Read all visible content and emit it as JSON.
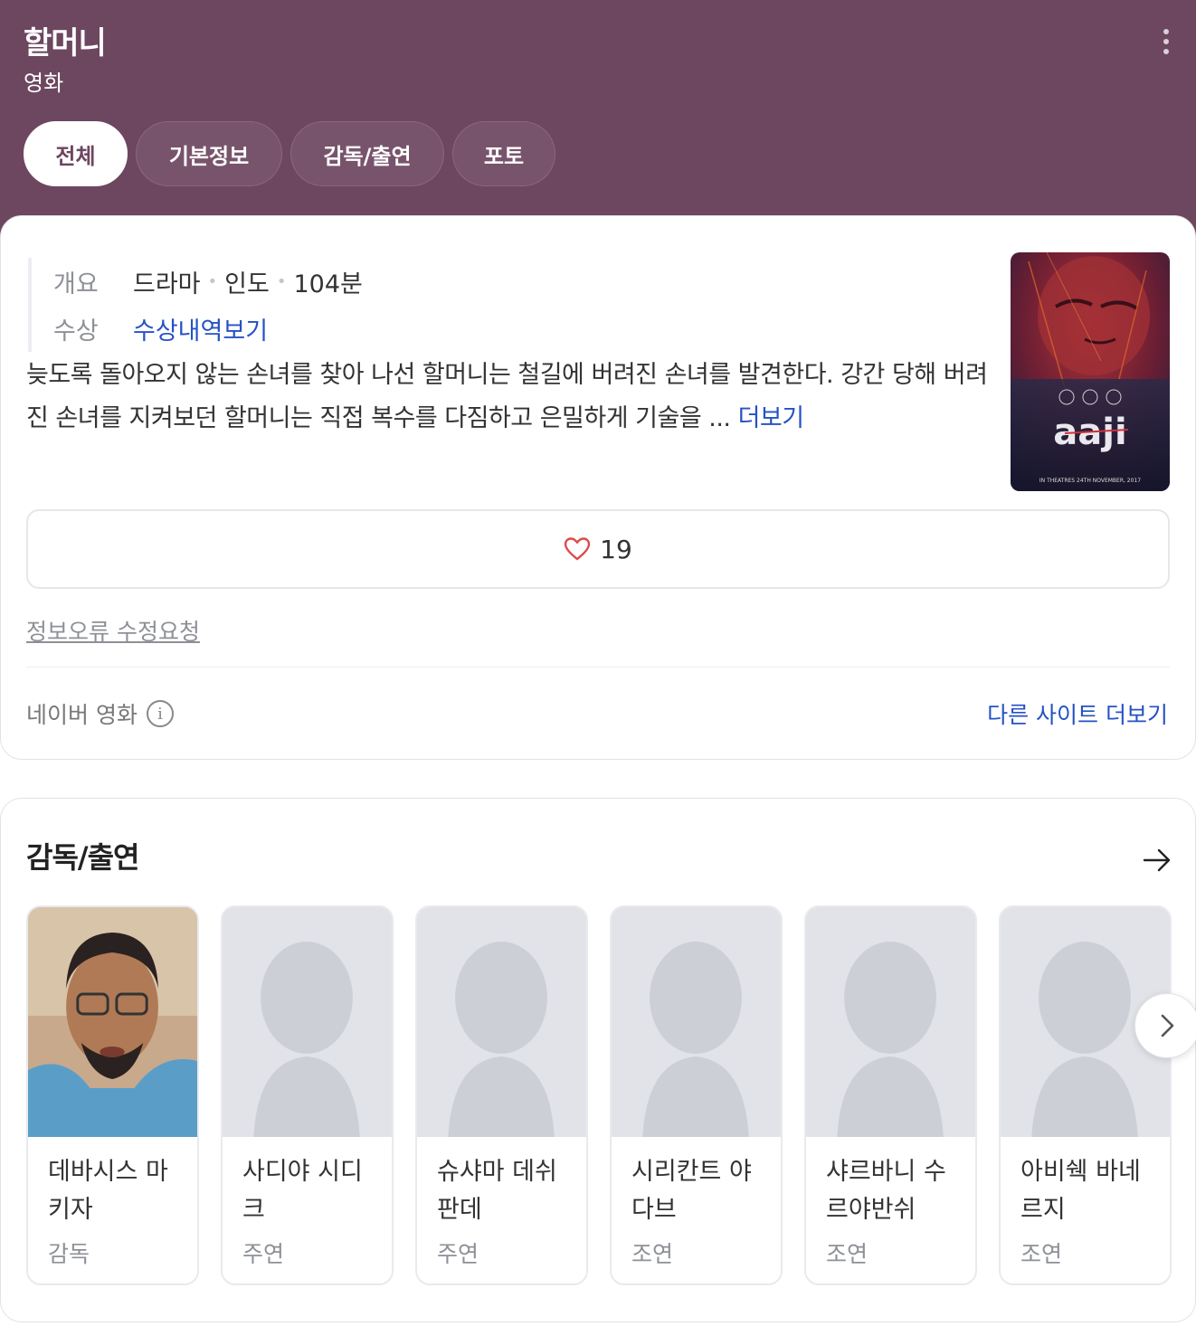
{
  "header": {
    "title": "할머니",
    "subtitle": "영화",
    "tabs": [
      {
        "label": "전체"
      },
      {
        "label": "기본정보"
      },
      {
        "label": "감독/출연"
      },
      {
        "label": "포토"
      }
    ]
  },
  "overview": {
    "key": "개요",
    "genre": "드라마",
    "country": "인도",
    "runtime": "104분",
    "award_key": "수상",
    "award_link": "수상내역보기",
    "synopsis": "늦도록 돌아오지 않는 손녀를 찾아 나선 할머니는 철길에 버려진 손녀를 발견한다. 강간 당해 버려진 손녀를 지켜보던 할머니는 직접 복수를 다짐하고 은밀하게 기술을 ... ",
    "synopsis_more": "더보기",
    "poster": {
      "title_art": "aaji",
      "footer": "IN THEATRES  24TH NOVEMBER, 2017"
    }
  },
  "like": {
    "count": "19"
  },
  "report_link": "정보오류 수정요청",
  "source": {
    "label": "네이버 영화",
    "other_sites": "다른 사이트 더보기"
  },
  "cast_section": {
    "title": "감독/출연",
    "people": [
      {
        "name": "데바시스 마키자",
        "role": "감독"
      },
      {
        "name": "사디야 시디크",
        "role": "주연"
      },
      {
        "name": "슈샤마 데쉬판데",
        "role": "주연"
      },
      {
        "name": "시리칸트 야다브",
        "role": "조연"
      },
      {
        "name": "샤르바니 수르야반쉬",
        "role": "조연"
      },
      {
        "name": "아비쉑 바네르지",
        "role": "조연"
      }
    ]
  },
  "colors": {
    "header_bg": "#6d4660",
    "link": "#2552c4",
    "heart": "#e04a4a"
  }
}
